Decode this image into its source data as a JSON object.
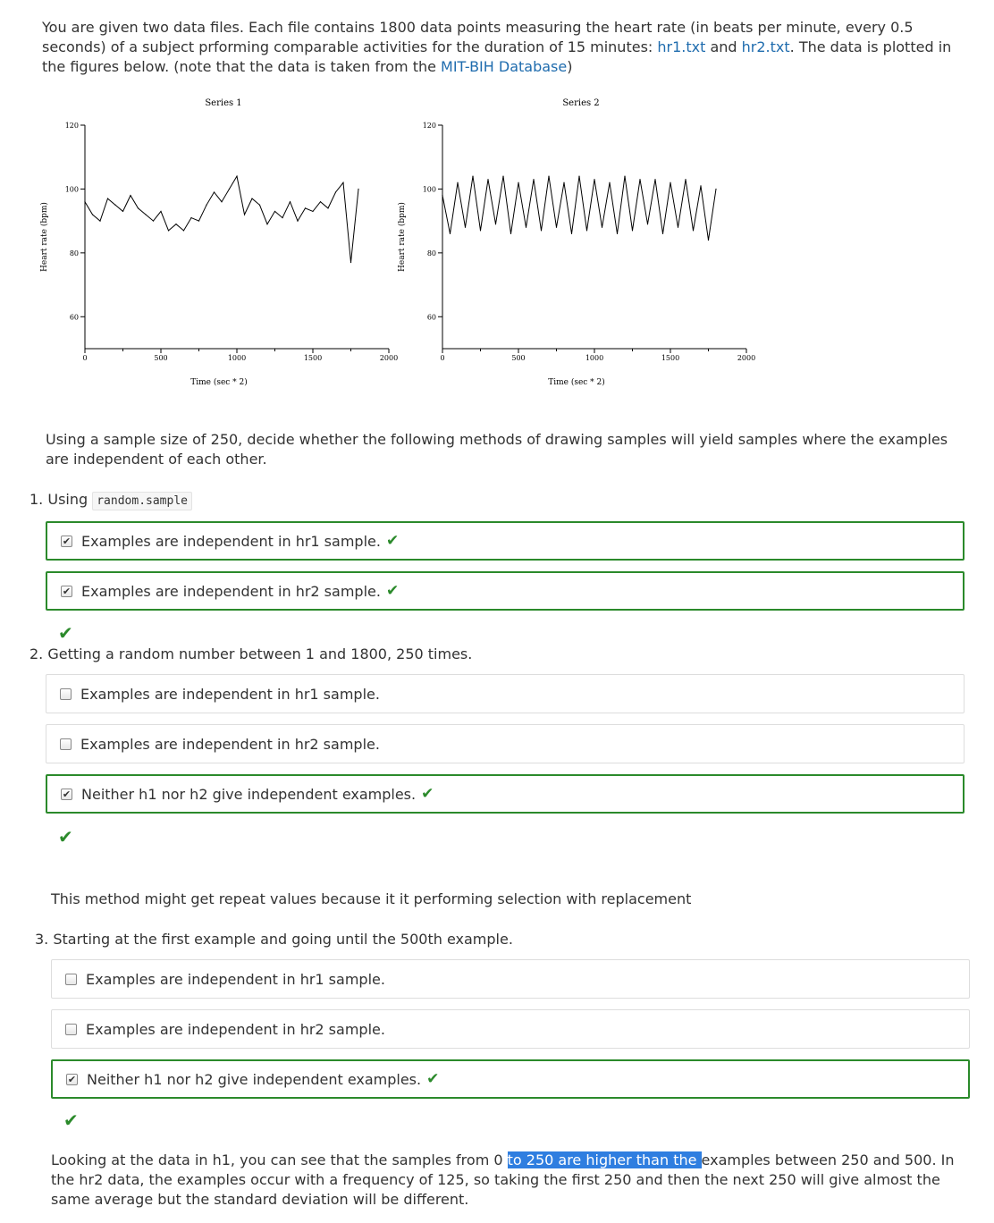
{
  "intro": {
    "text1": "You are given two data files. Each file contains 1800 data points measuring the heart rate (in beats per minute, every 0.5 seconds) of a subject prforming comparable activities for the duration of 15 minutes: ",
    "link1": "hr1.txt",
    "text2": " and ",
    "link2": "hr2.txt",
    "text3": ". The data is plotted in the figures below. (note that the data is taken from the ",
    "link3": "MIT-BIH Database",
    "text4": ")"
  },
  "chart_data": [
    {
      "type": "line",
      "title": "Series 1",
      "xlabel": "Time (sec * 2)",
      "ylabel": "Heart rate (bpm)",
      "xlim": [
        0,
        2000
      ],
      "ylim": [
        50,
        120
      ],
      "xticks": [
        "0",
        "500",
        "1000",
        "1500",
        "2000"
      ],
      "yticks": [
        "60",
        "80",
        "100",
        "120"
      ],
      "series": [
        {
          "x": [
            0,
            50,
            100,
            150,
            200,
            250,
            300,
            350,
            400,
            450,
            500,
            550,
            600,
            650,
            700,
            750,
            800,
            850,
            900,
            950,
            1000,
            1050,
            1100,
            1150,
            1200,
            1250,
            1300,
            1350,
            1400,
            1450,
            1500,
            1550,
            1600,
            1650,
            1700,
            1750,
            1800
          ],
          "y": [
            96,
            92,
            90,
            97,
            95,
            93,
            98,
            94,
            92,
            90,
            93,
            87,
            89,
            87,
            91,
            90,
            95,
            99,
            96,
            100,
            104,
            92,
            97,
            95,
            89,
            93,
            91,
            96,
            90,
            94,
            93,
            96,
            94,
            99,
            102,
            77,
            100
          ]
        }
      ]
    },
    {
      "type": "line",
      "title": "Series 2",
      "xlabel": "Time (sec * 2)",
      "ylabel": "Heart rate (bpm)",
      "xlim": [
        0,
        2000
      ],
      "ylim": [
        50,
        120
      ],
      "xticks": [
        "0",
        "500",
        "1000",
        "1500",
        "2000"
      ],
      "yticks": [
        "60",
        "80",
        "100",
        "120"
      ],
      "series": [
        {
          "x": [
            0,
            50,
            100,
            150,
            200,
            250,
            300,
            350,
            400,
            450,
            500,
            550,
            600,
            650,
            700,
            750,
            800,
            850,
            900,
            950,
            1000,
            1050,
            1100,
            1150,
            1200,
            1250,
            1300,
            1350,
            1400,
            1450,
            1500,
            1550,
            1600,
            1650,
            1700,
            1750,
            1800
          ],
          "y": [
            98,
            86,
            102,
            88,
            104,
            87,
            103,
            89,
            104,
            86,
            102,
            88,
            103,
            87,
            104,
            88,
            102,
            86,
            104,
            87,
            103,
            88,
            102,
            86,
            104,
            87,
            103,
            89,
            103,
            86,
            102,
            88,
            103,
            87,
            101,
            84,
            100
          ]
        }
      ]
    }
  ],
  "prompt": "Using a sample size of 250, decide whether the following methods of drawing samples will yield samples where the examples are independent of each other.",
  "q1": {
    "label_prefix": "1. Using ",
    "code": "random.sample",
    "options": [
      {
        "text": "Examples are independent in hr1 sample.",
        "checked": true,
        "correct": true
      },
      {
        "text": "Examples are independent in hr2 sample.",
        "checked": true,
        "correct": true
      }
    ]
  },
  "q2": {
    "label": "2. Getting a random number between 1 and 1800, 250 times.",
    "options": [
      {
        "text": "Examples are independent in hr1 sample.",
        "checked": false
      },
      {
        "text": "Examples are independent in hr2 sample.",
        "checked": false
      },
      {
        "text": "Neither h1 nor h2 give independent examples.",
        "checked": true,
        "correct": true
      }
    ],
    "explanation": "This method might get repeat values because it it performing selection with replacement"
  },
  "q3": {
    "label": "3. Starting at the first example and going until the 500th example.",
    "options": [
      {
        "text": "Examples are independent in hr1 sample.",
        "checked": false
      },
      {
        "text": "Examples are independent in hr2 sample.",
        "checked": false
      },
      {
        "text": "Neither h1 nor h2 give independent examples.",
        "checked": true,
        "correct": true
      }
    ],
    "explanation_a": "Looking at the data in h1, you can see that the samples from 0 ",
    "explanation_hl": "to 250 are higher than the ",
    "explanation_b": "examples between 250 and 500. In the hr2 data, the examples occur with a frequency of 125, so taking the first 250 and then the next 250 will give almost the same average but the standard deviation will be different."
  },
  "colors": {
    "correct": "#2b8a2b",
    "link": "#1f6cae",
    "highlight": "#2f7ee0"
  }
}
